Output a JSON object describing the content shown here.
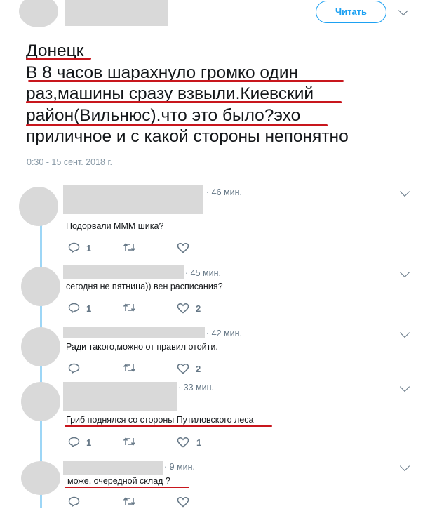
{
  "tweet": {
    "follow_label": "Читать",
    "text_lines": [
      "Донецк",
      " В 8 часов шарахнуло громко один",
      "раз,машины сразу взвыли.Киевский",
      "район(Вильнюс).что это было?эхо",
      "приличное и с какой стороны непонятно"
    ],
    "timestamp": "0:30 - 15 сент. 2018 г."
  },
  "replies": [
    {
      "time": "· 46 мин.",
      "text": "Подорвали МММ шика?",
      "reply_count": "1",
      "like_count": ""
    },
    {
      "time": "· 45 мин.",
      "text": "сегодня не пятница)) вен расписания?",
      "reply_count": "1",
      "like_count": "2"
    },
    {
      "time": "· 42 мин.",
      "text": "Ради такого,можно от правил отойти.",
      "reply_count": "",
      "like_count": "2"
    },
    {
      "time": "· 33 мин.",
      "text": "Гриб поднялся со стороны Путиловского леса",
      "reply_count": "1",
      "like_count": "1"
    },
    {
      "time": "· 9 мин.",
      "text": "може, очередной склад ?",
      "reply_count": "",
      "like_count": ""
    }
  ],
  "colors": {
    "accent": "#1da1f2",
    "underline": "#c8161d",
    "thread": "#9dd6f6",
    "muted": "#657786"
  },
  "icons": [
    "chevron-down-icon",
    "reply-icon",
    "retweet-icon",
    "like-icon"
  ]
}
